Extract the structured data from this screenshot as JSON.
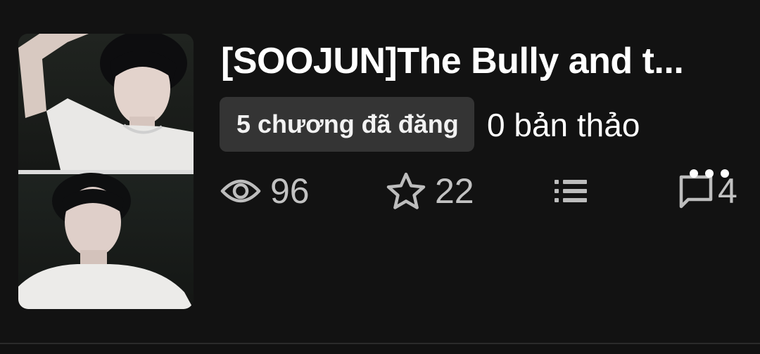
{
  "story": {
    "title": "[SOOJUN]The Bully and t...",
    "published_badge": "5 chương đã đăng",
    "drafts": "0 bản thảo",
    "cover_icon": "cover-image"
  },
  "stats": {
    "views": {
      "icon": "eye-icon",
      "value": "96"
    },
    "votes": {
      "icon": "star-icon",
      "value": "22"
    },
    "parts": {
      "icon": "list-icon"
    },
    "comments": {
      "icon": "comment-icon",
      "value": "4"
    },
    "more": {
      "icon": "more-dots-icon"
    }
  }
}
